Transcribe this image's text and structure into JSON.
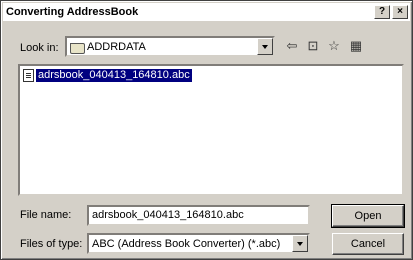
{
  "window": {
    "title": "Converting AddressBook",
    "help_label": "?",
    "close_label": "×"
  },
  "lookin": {
    "label": "Look in:",
    "value": "ADDRDATA"
  },
  "toolbar": {
    "back_glyph": "⇦",
    "up_glyph": "⊡",
    "newfolder_glyph": "☆",
    "views_glyph": "▦"
  },
  "files": [
    {
      "name": "adrsbook_040413_164810.abc"
    }
  ],
  "filename": {
    "label": "File name:",
    "value": "adrsbook_040413_164810.abc"
  },
  "filetype": {
    "label": "Files of type:",
    "value": "ABC (Address Book Converter) (*.abc)"
  },
  "buttons": {
    "open": "Open",
    "cancel": "Cancel"
  }
}
